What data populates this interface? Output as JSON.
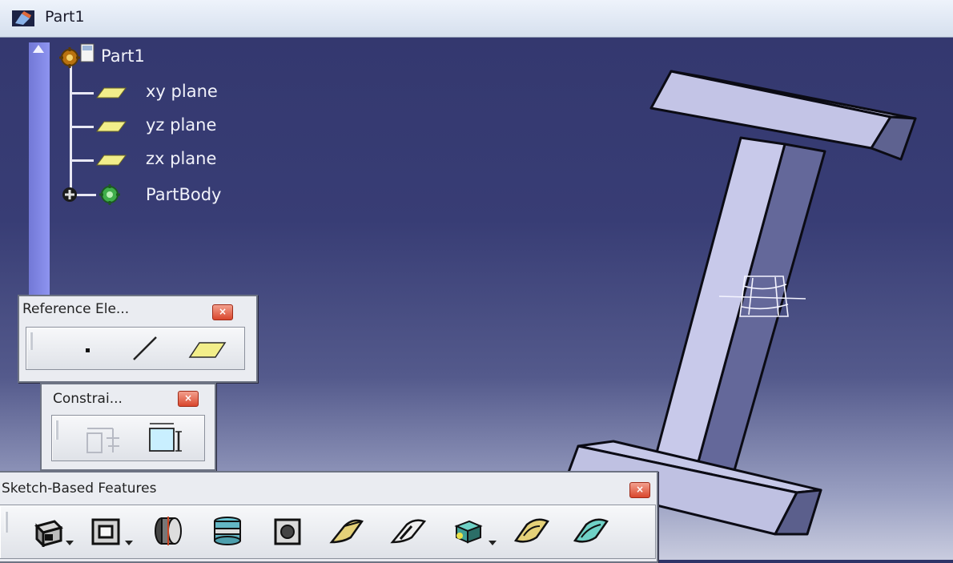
{
  "window": {
    "title": "Part1"
  },
  "tree": {
    "root": "Part1",
    "items": [
      "xy plane",
      "yz plane",
      "zx plane"
    ],
    "body": "PartBody"
  },
  "toolbars": {
    "reference": {
      "title": "Reference Ele...",
      "close": "×",
      "icons": [
        "point-icon",
        "line-icon",
        "plane-icon"
      ]
    },
    "constraint": {
      "title": "Constrai...",
      "close": "×",
      "icons": [
        "constraint-icon",
        "constraint-defined-in-dialog-icon"
      ]
    },
    "sketch_based": {
      "title": "Sketch-Based Features",
      "close": "×",
      "icons": [
        "pad-icon",
        "pocket-icon",
        "shaft-icon",
        "groove-icon",
        "hole-icon",
        "rib-icon",
        "slot-icon",
        "multi-sections-solid-icon",
        "removed-multi-sections-solid-icon",
        "stiffener-icon"
      ]
    }
  },
  "colors": {
    "viewport_top": "#34386f",
    "viewport_bottom": "#c9ccdf",
    "part_face": "#cacbec",
    "part_shadow": "#5e6290",
    "tree_text": "#f1f2fa",
    "close_button": "#d9472d"
  }
}
